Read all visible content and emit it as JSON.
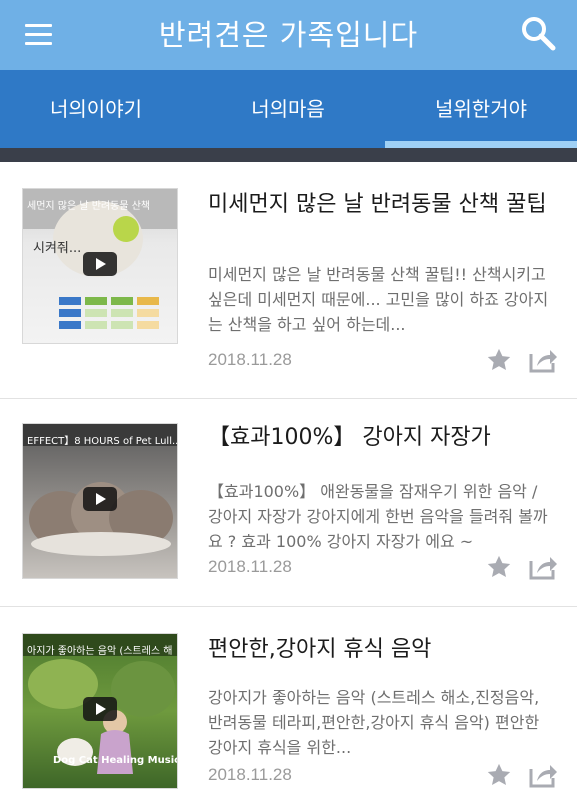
{
  "header": {
    "title": "반려견은 가족입니다",
    "menu_icon": "hamburger-menu-icon",
    "search_icon": "search-icon",
    "background_color": "#6fb0e6"
  },
  "tabs": {
    "background_color": "#2f79c6",
    "indicator_color": "#9fd0f5",
    "items": [
      {
        "label": "너의이야기"
      },
      {
        "label": "너의마음"
      },
      {
        "label": "널위한거야",
        "selected": true
      }
    ]
  },
  "posts": [
    {
      "title": "미세먼지 많은 날 반려동물 산책 꿀팁",
      "description": "미세먼지 많은 날 반려동물 산책 꿀팁!! 산책시키고 싶은데 미세먼지 때문에... 고민을 많이 하죠 강아지는 산책을 하고 싶어 하는데...",
      "date": "2018.11.28",
      "thumbnail_text": "세먼지 많은 날 반려동물 산책",
      "thumbnail_caption": "시켜줘...",
      "star_icon": "star-icon",
      "share_icon": "share-icon"
    },
    {
      "title": "【효과100%】 강아지 자장가",
      "description": "【효과100%】 애완동물을 잠재우기 위한 음악 / 강아지 자장가 강아지에게 한번 음악을 들려줘 볼까요 ? 효과 100% 강아지 자장가 에요 ~",
      "date": "2018.11.28",
      "thumbnail_text": "EFFECT】8 HOURS of Pet Lull...",
      "thumbnail_caption": "",
      "star_icon": "star-icon",
      "share_icon": "share-icon"
    },
    {
      "title": "편안한,강아지 휴식 음악",
      "description": "강아지가 좋아하는 음악 (스트레스 해소,진정음악,반려동물 테라피,편안한,강아지 휴식 음악) 편안한 강아지 휴식을 위한...",
      "date": "2018.11.28",
      "thumbnail_text": "아지가 좋아하는 음악 (스트레스 해",
      "thumbnail_caption": "Dog Cat Healing Music",
      "star_icon": "star-icon",
      "share_icon": "share-icon"
    }
  ]
}
